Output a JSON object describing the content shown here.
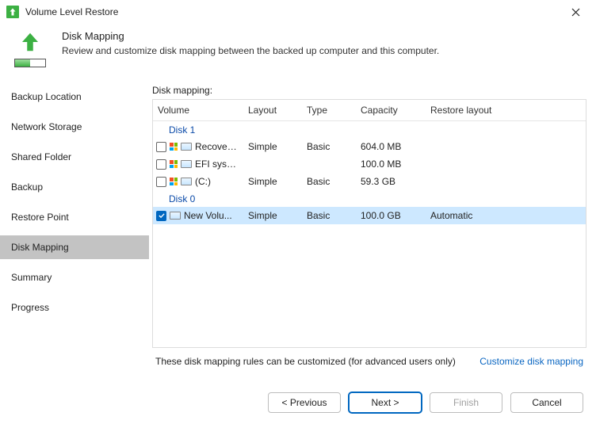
{
  "titlebar": {
    "title": "Volume Level Restore"
  },
  "header": {
    "title": "Disk Mapping",
    "desc": "Review and customize disk mapping between the backed up computer and this computer.",
    "progress_pct": 50
  },
  "sidebar": {
    "items": [
      {
        "label": "Backup Location",
        "active": false
      },
      {
        "label": "Network Storage",
        "active": false
      },
      {
        "label": "Shared Folder",
        "active": false
      },
      {
        "label": "Backup",
        "active": false
      },
      {
        "label": "Restore Point",
        "active": false
      },
      {
        "label": "Disk Mapping",
        "active": true
      },
      {
        "label": "Summary",
        "active": false
      },
      {
        "label": "Progress",
        "active": false
      }
    ]
  },
  "table": {
    "caption": "Disk mapping:",
    "columns": {
      "volume": "Volume",
      "layout": "Layout",
      "type": "Type",
      "capacity": "Capacity",
      "restore": "Restore layout"
    },
    "groups": [
      {
        "disk": "Disk 1",
        "rows": [
          {
            "checked": false,
            "winIcon": true,
            "name": "Recovery p...",
            "layout": "Simple",
            "type": "Basic",
            "capacity": "604.0 MB",
            "restore": "",
            "selected": false
          },
          {
            "checked": false,
            "winIcon": true,
            "name": "EFI system ...",
            "layout": "",
            "type": "",
            "capacity": "100.0 MB",
            "restore": "",
            "selected": false
          },
          {
            "checked": false,
            "winIcon": true,
            "name": "(C:)",
            "layout": "Simple",
            "type": "Basic",
            "capacity": "59.3 GB",
            "restore": "",
            "selected": false
          }
        ]
      },
      {
        "disk": "Disk 0",
        "rows": [
          {
            "checked": true,
            "winIcon": false,
            "name": "New Volu...",
            "layout": "Simple",
            "type": "Basic",
            "capacity": "100.0 GB",
            "restore": "Automatic",
            "selected": true
          }
        ]
      }
    ]
  },
  "footer": {
    "note": "These disk mapping rules can be customized (for advanced users only)",
    "link": "Customize disk mapping"
  },
  "buttons": {
    "previous": "<  Previous",
    "next": "Next  >",
    "finish": "Finish",
    "cancel": "Cancel"
  }
}
